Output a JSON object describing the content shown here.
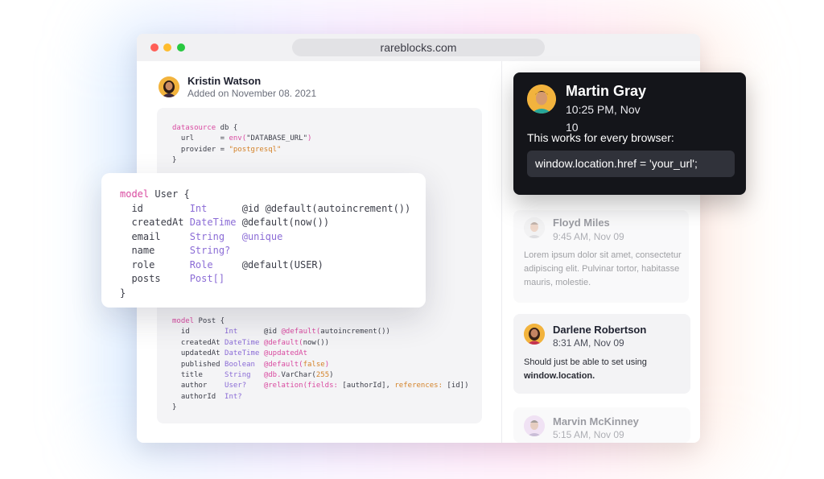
{
  "browser": {
    "url": "rareblocks.com",
    "traffic_lights": [
      "#ff5f57",
      "#febc2e",
      "#28c840"
    ]
  },
  "post": {
    "author": "Kristin Watson",
    "date": "Added on November 08. 2021"
  },
  "code_top": [
    [
      [
        "kw",
        "datasource"
      ],
      [
        "at",
        " db {"
      ]
    ],
    [
      [
        "at",
        "  url      = "
      ],
      [
        "kw",
        "env("
      ],
      [
        "at",
        "\"DATABASE_URL\""
      ],
      [
        "kw",
        ")"
      ]
    ],
    [
      [
        "at",
        "  provider = "
      ],
      [
        "str",
        "\"postgresql\""
      ]
    ],
    [
      [
        "at",
        "}"
      ]
    ]
  ],
  "code_popup": [
    [
      [
        "kw",
        "model"
      ],
      [
        "at",
        " User {"
      ]
    ],
    [
      [
        "at",
        "  id        "
      ],
      [
        "ty",
        "Int      "
      ],
      [
        "at",
        "@id @default(autoincrement())"
      ]
    ],
    [
      [
        "at",
        "  createdAt "
      ],
      [
        "ty",
        "DateTime "
      ],
      [
        "at",
        "@default(now())"
      ]
    ],
    [
      [
        "at",
        "  email     "
      ],
      [
        "ty",
        "String   "
      ],
      [
        "ty",
        "@unique"
      ]
    ],
    [
      [
        "at",
        "  name      "
      ],
      [
        "ty",
        "String?"
      ]
    ],
    [
      [
        "at",
        "  role      "
      ],
      [
        "ty",
        "Role     "
      ],
      [
        "at",
        "@default(USER)"
      ]
    ],
    [
      [
        "at",
        "  posts     "
      ],
      [
        "ty",
        "Post[]"
      ]
    ],
    [
      [
        "at",
        "}"
      ]
    ]
  ],
  "code_bottom": [
    [
      [
        "kw",
        "model"
      ],
      [
        "at",
        " Post {"
      ]
    ],
    [
      [
        "at",
        "  id        "
      ],
      [
        "ty",
        "Int      "
      ],
      [
        "at",
        "@id "
      ],
      [
        "kw",
        "@default("
      ],
      [
        "at",
        "autoincrement())"
      ]
    ],
    [
      [
        "at",
        "  createdAt "
      ],
      [
        "ty",
        "DateTime "
      ],
      [
        "kw",
        "@default("
      ],
      [
        "at",
        "now())"
      ]
    ],
    [
      [
        "at",
        "  updatedAt "
      ],
      [
        "ty",
        "DateTime "
      ],
      [
        "kw",
        "@updatedAt"
      ]
    ],
    [
      [
        "at",
        "  published "
      ],
      [
        "ty",
        "Boolean  "
      ],
      [
        "kw",
        "@default("
      ],
      [
        "str",
        "false"
      ],
      [
        "kw",
        ")"
      ]
    ],
    [
      [
        "at",
        "  title     "
      ],
      [
        "ty",
        "String   "
      ],
      [
        "kw",
        "@db."
      ],
      [
        "at",
        "VarChar("
      ],
      [
        "str",
        "255"
      ],
      [
        "at",
        ")"
      ]
    ],
    [
      [
        "at",
        "  author    "
      ],
      [
        "ty",
        "User?    "
      ],
      [
        "kw",
        "@relation("
      ],
      [
        "kw",
        "fields:"
      ],
      [
        "at",
        " [authorId], "
      ],
      [
        "str",
        "references:"
      ],
      [
        "at",
        " [id])"
      ]
    ],
    [
      [
        "at",
        "  authorId  "
      ],
      [
        "ty",
        "Int?"
      ]
    ],
    [
      [
        "at",
        "}"
      ]
    ]
  ],
  "comments": {
    "active": {
      "name": "Martin Gray",
      "time": "10:25 PM, Nov 10",
      "message": "This works for every browser:",
      "code": "window.location.href = 'your_url';"
    },
    "floyd": {
      "name": "Floyd Miles",
      "time": "9:45 AM, Nov 09",
      "message": "Lorem ipsum dolor sit amet, consectetur adipiscing elit. Pulvinar tortor, habitasse mauris, molestie."
    },
    "darlene": {
      "name": "Darlene Robertson",
      "time": "8:31 AM, Nov 09",
      "message_prefix": "Should just be able to set using",
      "message_bold": "window.location."
    },
    "marvin": {
      "name": "Marvin McKinney",
      "time": "5:15 AM, Nov 09"
    }
  }
}
